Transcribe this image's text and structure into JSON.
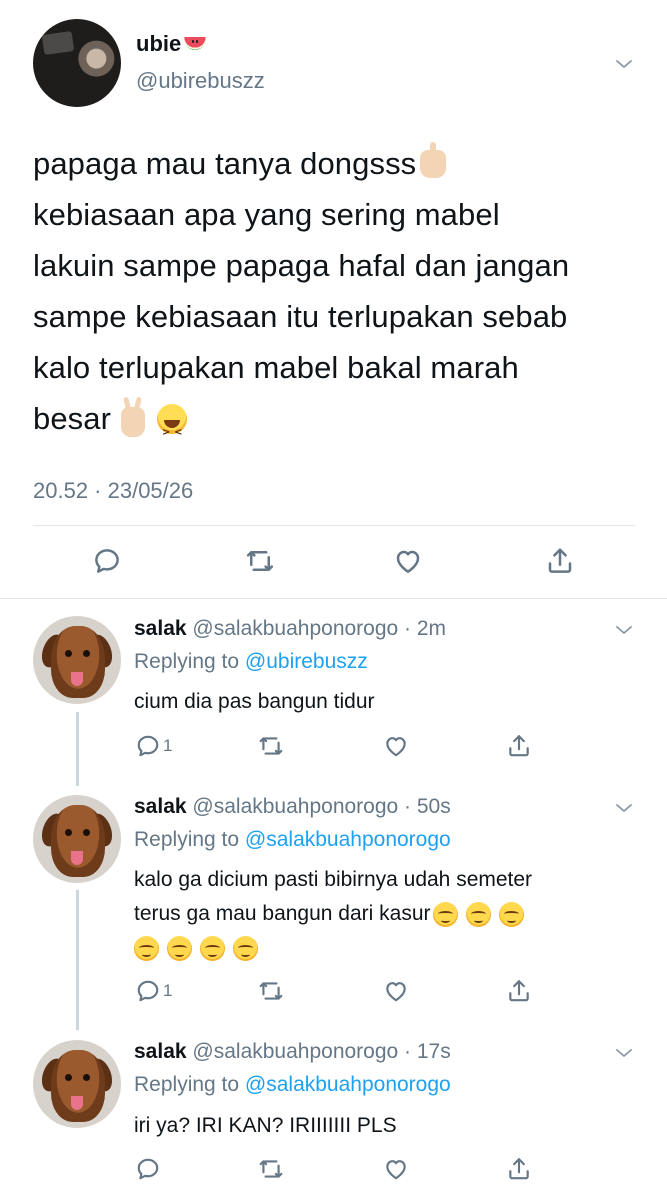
{
  "tweet": {
    "name": "ubie",
    "name_emoji": "watermelon-emoji",
    "handle": "@ubirebuszz",
    "lines": [
      "papaga mau tanya dongsss",
      "kebiasaan apa yang sering mabel",
      "lakuin sampe papaga hafal dan jangan",
      "sampe kebiasaan itu terlupakan sebab",
      "kalo terlupakan mabel bakal marah",
      "besar"
    ],
    "line1_emoji": "index-pointing-up-emoji",
    "line6_emojis": [
      "victory-hand-emoji",
      "grinning-squinting-face-emoji"
    ],
    "timestamp": "20.52 · 23/05/26",
    "actions": [
      "reply-icon",
      "retweet-icon",
      "like-icon",
      "share-icon"
    ]
  },
  "replies": [
    {
      "name": "salak",
      "handle_time": "@salakbuahponorogo · 2m",
      "replying_prefix": "Replying to",
      "replying_to": "@ubirebuszz",
      "lines": [
        "cium dia pas bangun tidur"
      ],
      "reply_count": "1"
    },
    {
      "name": "salak",
      "handle_time": "@salakbuahponorogo · 50s",
      "replying_prefix": "Replying to",
      "replying_to": "@salakbuahponorogo",
      "lines": [
        "kalo ga dicium pasti bibirnya udah semeter",
        "terus ga mau bangun dari kasur"
      ],
      "emoji": "smiling-face-emoji",
      "reply_count": "1"
    },
    {
      "name": "salak",
      "handle_time": "@salakbuahponorogo · 17s",
      "replying_prefix": "Replying to",
      "replying_to": "@salakbuahponorogo",
      "lines": [
        "iri ya? IRI KAN? IRIIIIIII PLS"
      ],
      "reply_count": ""
    }
  ],
  "colors": {
    "text": "#0f1419",
    "secondary": "#657786",
    "link": "#1da1f2",
    "divider": "#e1e8ed"
  }
}
